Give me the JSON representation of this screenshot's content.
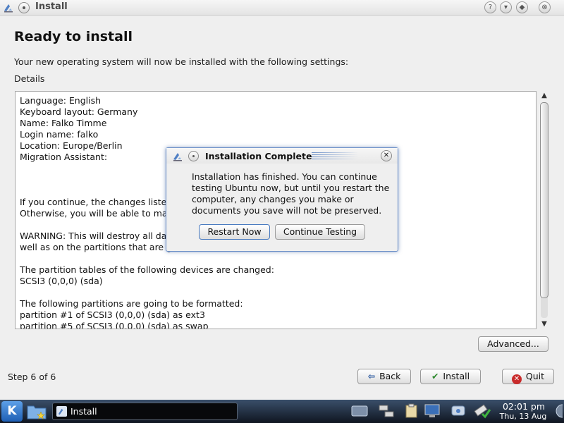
{
  "window": {
    "title": "Install",
    "buttons": {
      "help": "?",
      "minimize": "▾",
      "maximize": "◆",
      "close": "⊗"
    }
  },
  "page": {
    "heading": "Ready to install",
    "intro": "Your new operating system will now be installed with the following settings:",
    "details_label": "Details"
  },
  "details": {
    "lines": [
      "Language: English",
      "Keyboard layout: Germany",
      "Name: Falko Timme",
      "Login name: falko",
      "Location: Europe/Berlin",
      "Migration Assistant:",
      "",
      "",
      "",
      "If you continue, the changes listed",
      "Otherwise, you will be able to mak",
      "",
      "WARNING: This will destroy all data",
      "well as on the partitions that are g",
      "",
      "The partition tables of the following devices are changed:",
      "SCSI3 (0,0,0) (sda)",
      "",
      "The following partitions are going to be formatted:",
      "partition #1 of SCSI3 (0,0,0) (sda) as ext3",
      "partition #5 of SCSI3 (0,0,0) (sda) as swap"
    ]
  },
  "buttons": {
    "advanced": "Advanced...",
    "back": "Back",
    "install": "Install",
    "quit": "Quit"
  },
  "step": "Step 6 of 6",
  "dialog": {
    "title": "Installation Complete",
    "message": "Installation has finished. You can continue testing Ubuntu now, but until you restart the computer, any changes you make or documents you save will not be preserved.",
    "restart_label": "Restart Now",
    "continue_label": "Continue Testing"
  },
  "taskbar": {
    "task_label": "Install",
    "clock_time": "02:01 pm",
    "clock_date": "Thu, 13 Aug",
    "k_label": "K"
  },
  "icons": {
    "app": "installer-icon",
    "back": "arrow-left-icon",
    "install": "checkmark-icon",
    "quit": "stop-icon"
  },
  "colors": {
    "accent": "#4a7bc0",
    "taskbar": "#1c2533"
  }
}
